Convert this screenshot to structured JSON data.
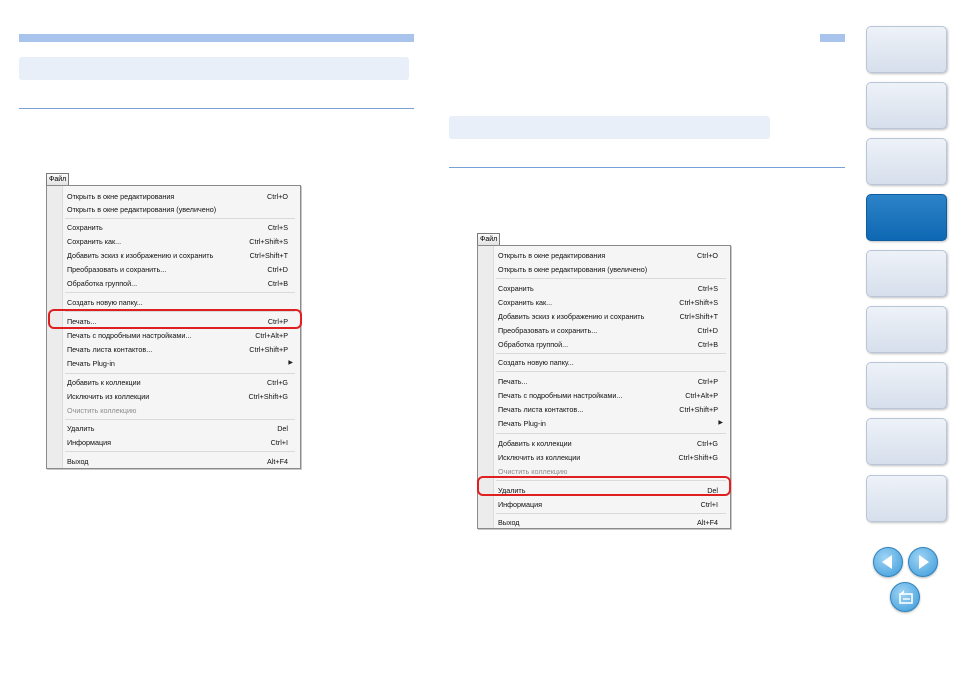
{
  "menu": {
    "tab_label": "Файл",
    "items": [
      {
        "label": "Открыть в окне редактирования",
        "shortcut": "Ctrl+O"
      },
      {
        "label": "Открыть в окне редактирования (увеличено)",
        "shortcut": ""
      },
      {
        "label": "Сохранить",
        "shortcut": "Ctrl+S"
      },
      {
        "label": "Сохранить как...",
        "shortcut": "Ctrl+Shift+S"
      },
      {
        "label": "Добавить эскиз к изображению и сохранить",
        "shortcut": "Ctrl+Shift+T"
      },
      {
        "label": "Преобразовать и сохранить...",
        "shortcut": "Ctrl+D"
      },
      {
        "label": "Обработка группой...",
        "shortcut": "Ctrl+B"
      },
      {
        "label": "Создать новую папку...",
        "shortcut": ""
      },
      {
        "label": "Печать...",
        "shortcut": "Ctrl+P"
      },
      {
        "label": "Печать с подробными настройками...",
        "shortcut": "Ctrl+Alt+P"
      },
      {
        "label": "Печать листа контактов...",
        "shortcut": "Ctrl+Shift+P"
      },
      {
        "label": "Печать Plug-in",
        "shortcut": ""
      },
      {
        "label": "Добавить к коллекции",
        "shortcut": "Ctrl+G"
      },
      {
        "label": "Исключить из коллекции",
        "shortcut": "Ctrl+Shift+G"
      },
      {
        "label": "Очистить коллекцию",
        "shortcut": ""
      },
      {
        "label": "Удалить",
        "shortcut": "Del"
      },
      {
        "label": "Информация",
        "shortcut": "Ctrl+I"
      },
      {
        "label": "Выход",
        "shortcut": "Alt+F4"
      }
    ]
  },
  "highlight": {
    "left_menu": "Печать...",
    "right_menu": "Удалить"
  },
  "icons": {
    "prev": "arrow-left-icon",
    "next": "arrow-right-icon",
    "return": "return-icon"
  },
  "colors": {
    "accent": "#0f68b3",
    "highlight_border": "#e02020",
    "banner": "#e8eff9"
  }
}
